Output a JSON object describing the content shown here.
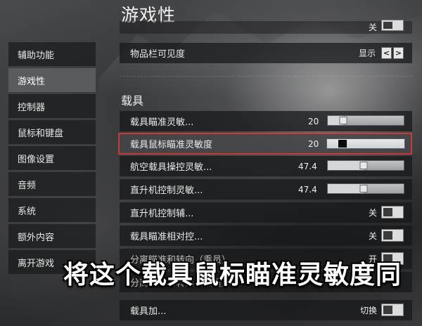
{
  "header": {
    "title": "游戏性"
  },
  "sidebar": {
    "items": [
      {
        "label": "辅助功能"
      },
      {
        "label": "游戏性"
      },
      {
        "label": "控制器"
      },
      {
        "label": "鼠标和键盘"
      },
      {
        "label": "图像设置"
      },
      {
        "label": "音频"
      },
      {
        "label": "系统"
      },
      {
        "label": "额外内容"
      },
      {
        "label": "离开游戏"
      }
    ],
    "active_index": 1
  },
  "settings": {
    "partial_top_row": {
      "label": "",
      "value": "关"
    },
    "inventory": {
      "label": "物品栏可见度",
      "value": "显示",
      "prev": "<",
      "next": ">"
    },
    "vehicle_section_title": "载具",
    "rows": [
      {
        "label": "载具瞄准灵敏...",
        "value": "20",
        "slider_fraction": 0.2
      },
      {
        "label": "载具鼠标瞄准灵敏度",
        "value": "20",
        "slider_fraction": 0.2
      },
      {
        "label": "航空载具操控灵敏...",
        "value": "47.4",
        "slider_fraction": 0.47
      },
      {
        "label": "直升机控制灵敏...",
        "value": "47.4",
        "slider_fraction": 0.47
      },
      {
        "label": "直升机控制辅...",
        "value": "关"
      },
      {
        "label": "载具瞄准相对控...",
        "value": "关"
      },
      {
        "label": "分离瞄准和转向（乘员）",
        "value": "开"
      },
      {
        "label": "分离瞄准和转向（乘员）",
        "value": ""
      },
      {
        "label": "载具加...",
        "value": "切换"
      }
    ]
  },
  "subtitle": "将这个载具鼠标瞄准灵敏度同"
}
